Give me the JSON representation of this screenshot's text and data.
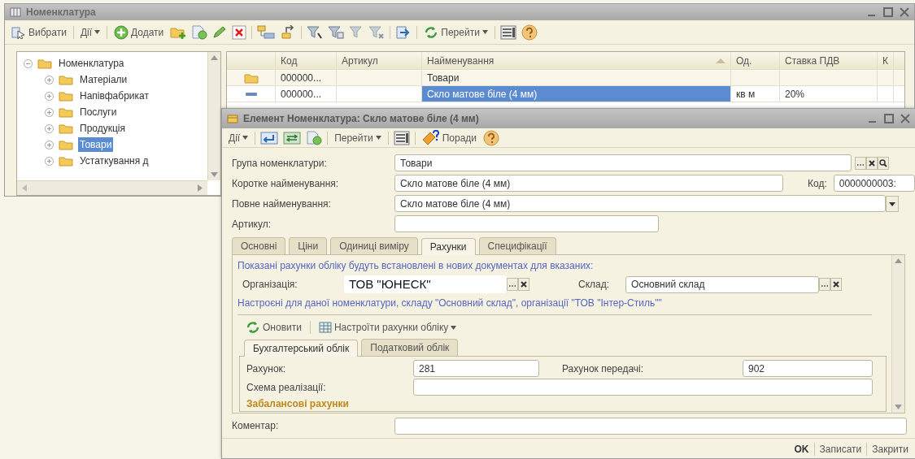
{
  "main_window": {
    "title": "Номенклатура",
    "toolbar": [
      {
        "label": "Вибрати",
        "dropdown": false
      },
      {
        "label": "Дії",
        "dropdown": true
      },
      {
        "label": "Додати",
        "dropdown": false
      },
      {
        "label": "Перейти",
        "dropdown": true
      }
    ],
    "tree": [
      {
        "label": "Номенклатура",
        "expanded": true,
        "selected": false,
        "children": [
          {
            "label": "Матеріали",
            "expanded": false,
            "selected": false
          },
          {
            "label": "Напівфабрикат",
            "expanded": false,
            "selected": false
          },
          {
            "label": "Послуги",
            "expanded": false,
            "selected": false
          },
          {
            "label": "Продукція",
            "expanded": false,
            "selected": false
          },
          {
            "label": "Товари",
            "expanded": false,
            "selected": true
          },
          {
            "label": "Устаткування д",
            "expanded": false,
            "selected": false
          }
        ]
      }
    ],
    "table": {
      "columns": [
        {
          "label": "Код",
          "sorted": false
        },
        {
          "label": "Артикул",
          "sorted": false
        },
        {
          "label": "Найменування",
          "sorted": true
        },
        {
          "label": "Од.",
          "sorted": false
        },
        {
          "label": "Ставка ПДВ",
          "sorted": false
        },
        {
          "label": "К",
          "sorted": false
        }
      ],
      "rows": [
        {
          "kind": "group",
          "code": "000000...",
          "name": "Товари",
          "selected": false
        },
        {
          "kind": "item",
          "code": "000000...",
          "name": "Скло матове біле (4 мм)",
          "unit": "кв м",
          "vat": "20%",
          "selected": true
        }
      ]
    }
  },
  "dialog": {
    "title": "Елемент Номенклатура: Скло матове біле (4 мм)",
    "toolbar": [
      {
        "label": "Дії",
        "dropdown": true
      },
      {
        "label": "Перейти",
        "dropdown": true
      },
      {
        "label": "Поради",
        "dropdown": false
      }
    ],
    "group": {
      "label": "Група номенклатури:",
      "value": "Товари"
    },
    "short_name": {
      "label": "Коротке найменування:",
      "value": "Скло матове біле (4 мм)"
    },
    "code": {
      "label": "Код:",
      "value": "0000000003:"
    },
    "full_name": {
      "label": "Повне найменування:",
      "value": "Скло матове біле (4 мм)"
    },
    "article": {
      "label": "Артикул:"
    },
    "tabs": [
      {
        "label": "Основні",
        "selected": false
      },
      {
        "label": "Ціни",
        "selected": false
      },
      {
        "label": "Одиниці виміру",
        "selected": false
      },
      {
        "label": "Рахунки",
        "selected": true
      },
      {
        "label": "Специфікації",
        "selected": false
      }
    ],
    "accounts": {
      "note": "Показані рахунки обліку будуть встановлені в нових документах для вказаних:",
      "organization": {
        "label": "Організація:",
        "value": "ТОВ \"ЮНЕСК\""
      },
      "warehouse": {
        "label": "Склад:",
        "value": "Основний склад"
      },
      "settings_note": "Настроєні для даної номенклатури, складу \"Основний склад\", організації \"ТОВ \"Інтер-Стиль\"\"",
      "toolbar": [
        {
          "label": "Оновити",
          "dropdown": false
        },
        {
          "label": "Настроїти рахунки обліку",
          "dropdown": true
        }
      ],
      "subtabs": [
        {
          "label": "Бухгалтерський облік",
          "selected": true
        },
        {
          "label": "Податковий облік",
          "selected": false
        }
      ],
      "account": {
        "label": "Рахунок:",
        "value": "281"
      },
      "transfer_account": {
        "label": "Рахунок передачі:",
        "value": "902"
      },
      "scheme": {
        "label": "Схема реалізації:"
      },
      "section": "Забалансові рахунки"
    },
    "comment": {
      "label": "Коментар:"
    },
    "buttons": [
      {
        "label": "OK",
        "default": true
      },
      {
        "label": "Записати",
        "default": false
      },
      {
        "label": "Закрити",
        "default": false
      }
    ]
  }
}
